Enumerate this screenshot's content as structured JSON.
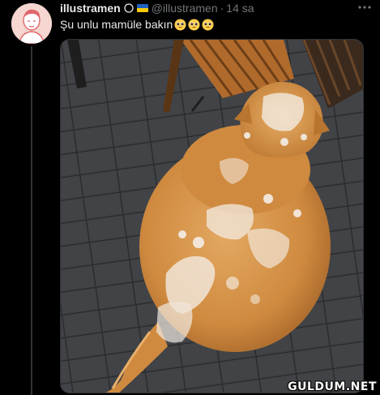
{
  "tweet": {
    "author_name": "illustramen",
    "handle": "@illustramen",
    "separator": "·",
    "time": "14 sa",
    "text": "Şu unlu mamüle bakın",
    "emoji_count": 3
  },
  "media": {
    "subject": "dog-photo"
  },
  "watermark": {
    "text": "GULDUM.NET"
  },
  "colors": {
    "background": "#000000",
    "primary_text": "#e7e9ea",
    "secondary_text": "#71767b",
    "divider": "#2f3336"
  }
}
